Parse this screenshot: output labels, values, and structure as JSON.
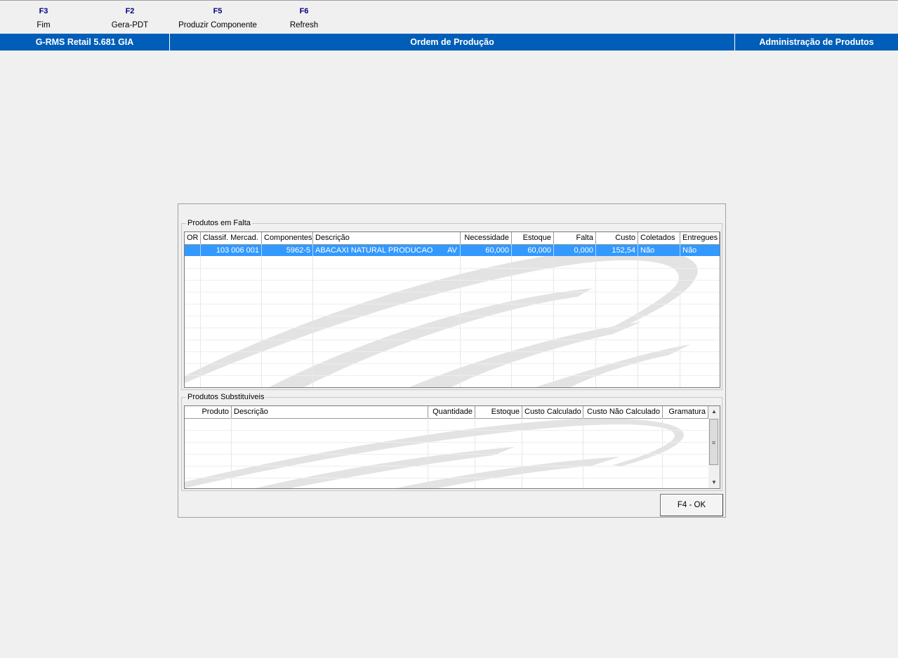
{
  "function_keys": [
    {
      "key": "F3",
      "label": "Fim"
    },
    {
      "key": "F2",
      "label": "Gera-PDT"
    },
    {
      "key": "F5",
      "label": "Produzir Componente"
    },
    {
      "key": "F6",
      "label": "Refresh"
    }
  ],
  "title_bar": {
    "app": "G-RMS Retail 5.681 GIA",
    "screen": "Ordem de Produção",
    "module": "Administração de Produtos"
  },
  "missing_products": {
    "legend": "Produtos em Falta",
    "columns": [
      "OR",
      "Classif. Mercad.",
      "Componentes",
      "Descrição",
      "Necessidade",
      "Estoque",
      "Falta",
      "Custo",
      "Coletados",
      "Entregues"
    ],
    "rows": [
      {
        "or": "",
        "classif": "103  006  001",
        "componente": "5962-5",
        "descricao": "ABACAXI NATURAL PRODUCAO",
        "unidade": "AV",
        "necessidade": "60,000",
        "estoque": "60,000",
        "falta": "0,000",
        "custo": "152,54",
        "coletados": "Não",
        "entregues": "Não",
        "selected": true
      }
    ]
  },
  "substitute_products": {
    "legend": "Produtos Substituíveis",
    "columns": [
      "Produto",
      "Descrição",
      "Quantidade",
      "Estoque",
      "Custo Calculado",
      "Custo Não Calculado",
      "Gramatura"
    ],
    "rows": []
  },
  "buttons": {
    "ok": "F4 - OK"
  },
  "icons": {
    "scroll_up": "scroll-up-arrow-icon",
    "scroll_down": "scroll-down-arrow-icon",
    "scroll_grip": "scroll-grip-icon"
  }
}
